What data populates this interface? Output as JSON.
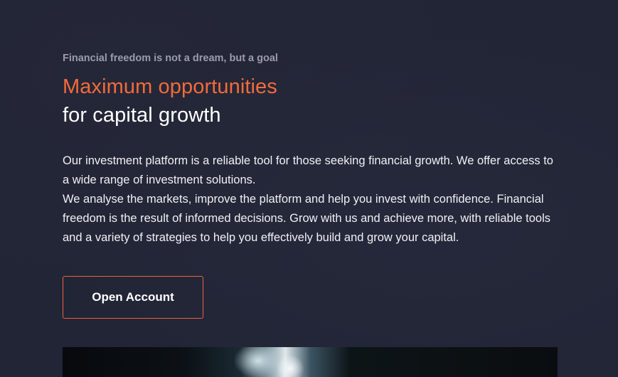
{
  "hero": {
    "eyebrow": "Financial freedom is not a dream, but a goal",
    "title_accent": "Maximum opportunities",
    "title_rest": "for capital growth",
    "paragraph_1": "Our investment platform is a reliable tool for those seeking financial growth. We offer access to a wide range of investment solutions.",
    "paragraph_2": "We analyse the markets, improve the platform and help you invest with confidence. Financial freedom is the result of informed decisions. Grow with us and achieve more, with reliable tools and a variety of strategies to help you effectively build and grow your capital.",
    "cta_label": "Open Account"
  },
  "colors": {
    "background": "#222536",
    "accent": "#f26b3a",
    "eyebrow": "#9a9cab",
    "text": "#ffffff"
  }
}
